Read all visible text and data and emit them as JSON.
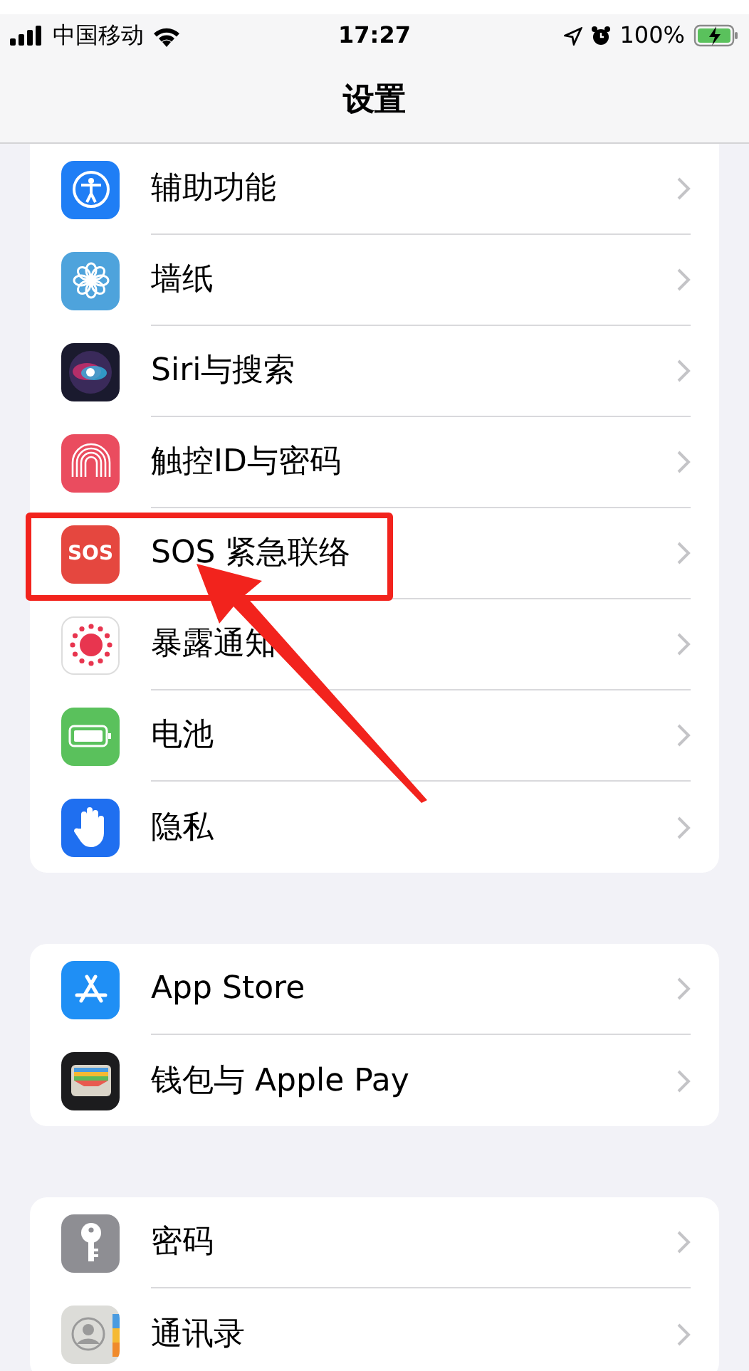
{
  "status_bar": {
    "carrier": "中国移动",
    "time": "17:27",
    "battery": "100%"
  },
  "nav": {
    "title": "设置"
  },
  "groups": [
    {
      "items": [
        {
          "kind": "accessibility",
          "label": "辅助功能",
          "highlighted": false
        },
        {
          "kind": "wallpaper",
          "label": "墙纸",
          "highlighted": false
        },
        {
          "kind": "siri",
          "label": "Siri与搜索",
          "highlighted": false
        },
        {
          "kind": "fingerprint",
          "label": "触控ID与密码",
          "highlighted": false
        },
        {
          "kind": "sos",
          "badge": "SOS",
          "label": "SOS 紧急联络",
          "highlighted": true
        },
        {
          "kind": "exposure",
          "label": "暴露通知",
          "highlighted": false
        },
        {
          "kind": "battery",
          "label": "电池",
          "highlighted": false
        },
        {
          "kind": "privacy",
          "label": "隐私",
          "highlighted": false
        }
      ]
    },
    {
      "items": [
        {
          "kind": "appstore",
          "label": "App Store",
          "highlighted": false
        },
        {
          "kind": "wallet",
          "label": "钱包与 Apple Pay",
          "highlighted": false
        }
      ]
    },
    {
      "items": [
        {
          "kind": "passwords",
          "label": "密码",
          "highlighted": false
        },
        {
          "kind": "contacts",
          "label": "通讯录",
          "highlighted": false
        }
      ]
    }
  ]
}
